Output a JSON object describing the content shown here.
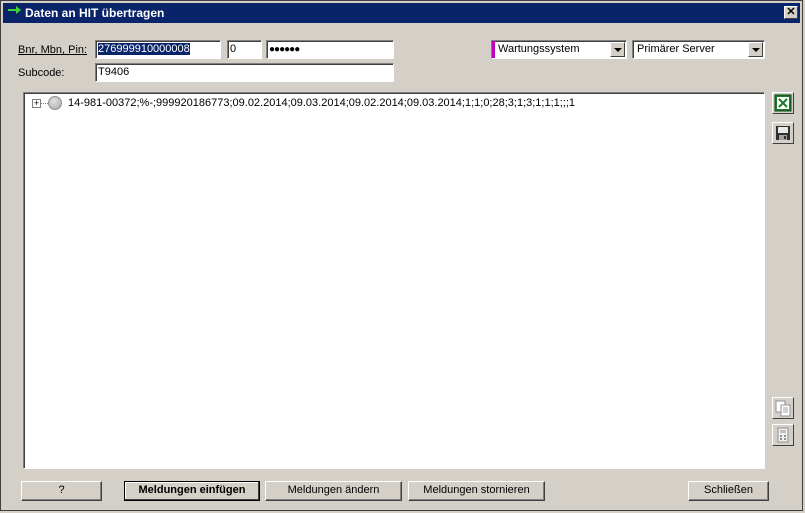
{
  "window": {
    "title": "Daten an HIT übertragen"
  },
  "form": {
    "credentials_label": "Bnr, Mbn, Pin:",
    "bnr_value": "276999910000008",
    "mbn_value": "0",
    "pin_value": "●●●●●●",
    "subcode_label": "Subcode:",
    "subcode_value": "T9406",
    "system_selected": "Wartungssystem",
    "server_selected": "Primärer Server"
  },
  "tree": {
    "items": [
      {
        "text": "14-981-00372;%-;999920186773;09.02.2014;09.03.2014;09.02.2014;09.03.2014;1;1;0;28;3;1;3;1;1;1;;;1"
      }
    ]
  },
  "buttons": {
    "help_label": "?",
    "insert_label": "Meldungen einfügen",
    "change_label": "Meldungen ändern",
    "cancel_label": "Meldungen stornieren",
    "close_label": "Schließen"
  },
  "icons": {
    "title": "arrow-icon",
    "excel": "excel-icon",
    "save": "save-icon",
    "copy": "copy-icon",
    "calc": "calculator-icon"
  },
  "colors": {
    "titlebar": "#0a246a",
    "face": "#d4d0c8",
    "selection": "#0a246a",
    "excel_green": "#1a7a2a",
    "magenta_marker": "#c000c0"
  }
}
